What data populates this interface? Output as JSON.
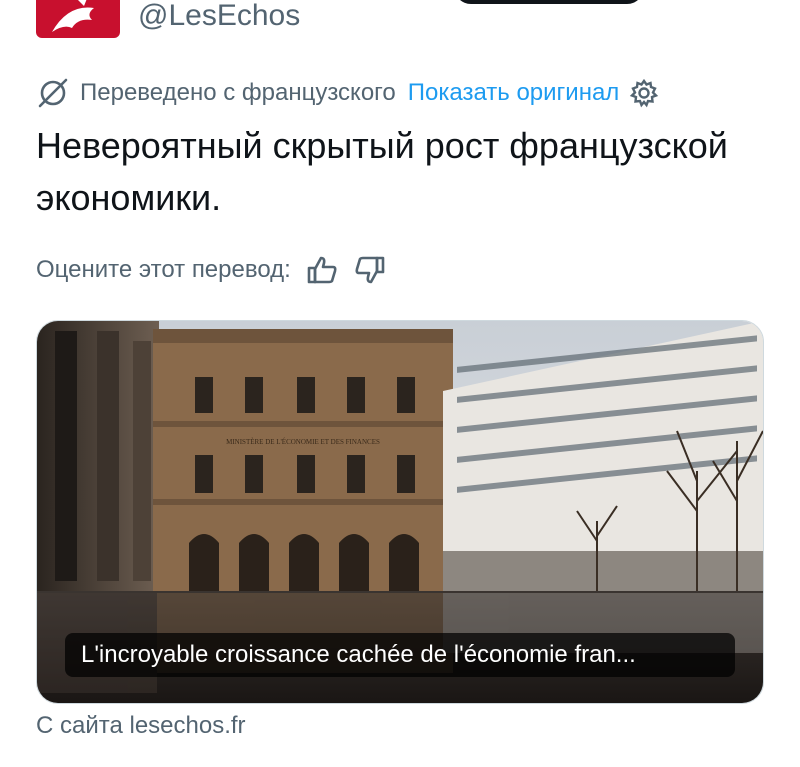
{
  "account": {
    "handle": "@LesEchos",
    "brand_color": "#c8102e",
    "avatar_icon": "les-echos-logo"
  },
  "translation": {
    "icon": "translate-icon",
    "label": "Переведено с французского",
    "show_original": "Показать оригинал",
    "settings_icon": "gear-icon"
  },
  "tweet": {
    "text": "Невероятный скрытый рост французской экономики."
  },
  "rating": {
    "label": "Оцените этот перевод:",
    "like_icon": "thumbs-up-icon",
    "dislike_icon": "thumbs-down-icon"
  },
  "card": {
    "caption": "L'incroyable croissance cachée de l'économie fran...",
    "facade_text": "MINISTÈRE DE L'ÉCONOMIE ET DES FINANCES",
    "source": "С сайта lesechos.fr"
  },
  "colors": {
    "link": "#1d9bf0",
    "secondary_text": "#536471",
    "primary_text": "#0f1419"
  }
}
